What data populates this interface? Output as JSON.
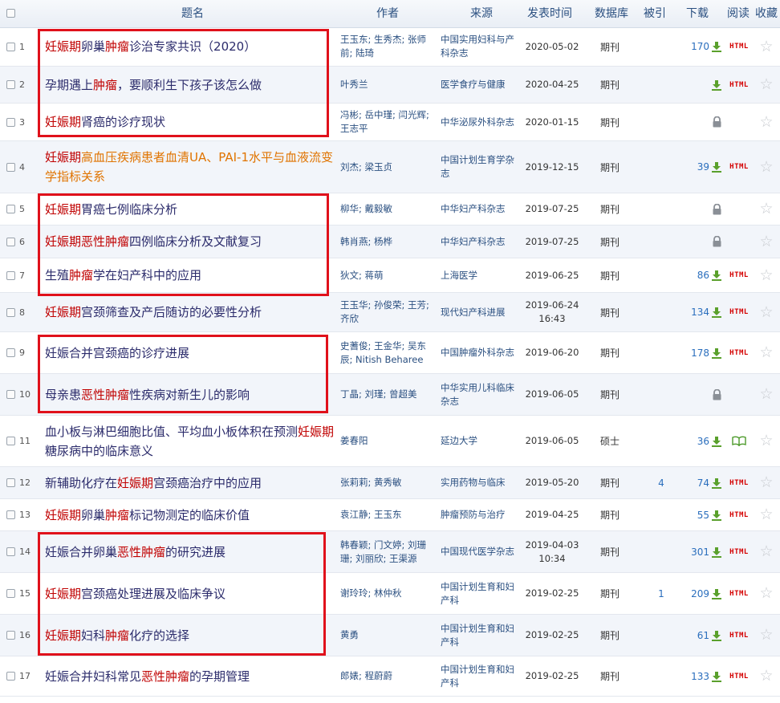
{
  "header": {
    "title": "题名",
    "author": "作者",
    "source": "来源",
    "date": "发表时间",
    "db": "数据库",
    "cited": "被引",
    "download": "下载",
    "read": "阅读",
    "fav": "收藏"
  },
  "html_label": "HTML",
  "rows": [
    {
      "num": "1",
      "title": [
        [
          "妊娠期",
          true
        ],
        [
          "卵巢",
          false
        ],
        [
          "肿瘤",
          true
        ],
        [
          "诊治专家共识（2020）",
          false
        ]
      ],
      "author": "王玉东; 生秀杰; 张师前; 陆琦",
      "source": "中国实用妇科与产科杂志",
      "date": "2020-05-02",
      "db": "期刊",
      "cited": "",
      "downloads": "170",
      "dl": "arrow",
      "read": "html"
    },
    {
      "num": "2",
      "title": [
        [
          "孕期遇上",
          false
        ],
        [
          "肿瘤",
          true
        ],
        [
          "，要顺利生下孩子该怎么做",
          false
        ]
      ],
      "author": "叶秀兰",
      "source": "医学食疗与健康",
      "date": "2020-04-25",
      "db": "期刊",
      "cited": "",
      "downloads": "",
      "dl": "arrow",
      "read": "html"
    },
    {
      "num": "3",
      "title": [
        [
          "妊娠期",
          true
        ],
        [
          "肾癌的诊疗现状",
          false
        ]
      ],
      "author": "冯彬; 岳中瑾; 闫光辉; 王志平",
      "source": "中华泌尿外科杂志",
      "date": "2020-01-15",
      "db": "期刊",
      "cited": "",
      "downloads": "",
      "dl": "lock",
      "read": "none"
    },
    {
      "num": "4",
      "title": [
        [
          "妊娠期",
          true
        ],
        [
          "高血压疾病患者血清UA、PAI-1水平与血液流变学指标关系",
          false
        ]
      ],
      "orange": true,
      "author": "刘杰; 梁玉贞",
      "source": "中国计划生育学杂志",
      "date": "2019-12-15",
      "db": "期刊",
      "cited": "",
      "downloads": "39",
      "dl": "arrow",
      "read": "html"
    },
    {
      "num": "5",
      "title": [
        [
          "妊娠期",
          true
        ],
        [
          "胃癌七例临床分析",
          false
        ]
      ],
      "author": "柳华; 戴毅敏",
      "source": "中华妇产科杂志",
      "date": "2019-07-25",
      "db": "期刊",
      "cited": "",
      "downloads": "",
      "dl": "lock",
      "read": "none"
    },
    {
      "num": "6",
      "title": [
        [
          "妊娠期恶性肿瘤",
          true
        ],
        [
          "四例临床分析及文献复习",
          false
        ]
      ],
      "author": "韩肖燕; 杨桦",
      "source": "中华妇产科杂志",
      "date": "2019-07-25",
      "db": "期刊",
      "cited": "",
      "downloads": "",
      "dl": "lock",
      "read": "none"
    },
    {
      "num": "7",
      "title": [
        [
          "生殖",
          false
        ],
        [
          "肿瘤",
          true
        ],
        [
          "学在妇产科中的应用",
          false
        ]
      ],
      "author": "狄文; 蒋萌",
      "source": "上海医学",
      "date": "2019-06-25",
      "db": "期刊",
      "cited": "",
      "downloads": "86",
      "dl": "arrow",
      "read": "html"
    },
    {
      "num": "8",
      "title": [
        [
          "妊娠期",
          true
        ],
        [
          "宫颈筛查及产后随访的必要性分析",
          false
        ]
      ],
      "author": "王玉华; 孙俊荣; 王芳; 齐欣",
      "source": "现代妇产科进展",
      "date": "2019-06-24 16:43",
      "db": "期刊",
      "cited": "",
      "downloads": "134",
      "dl": "arrow",
      "read": "html"
    },
    {
      "num": "9",
      "title": [
        [
          "妊娠合并宫颈癌的诊疗进展",
          false
        ]
      ],
      "author": "史蓍俊; 王金华; 吴东辰; Nitish Beharee",
      "source": "中国肿瘤外科杂志",
      "date": "2019-06-20",
      "db": "期刊",
      "cited": "",
      "downloads": "178",
      "dl": "arrow",
      "read": "html"
    },
    {
      "num": "10",
      "title": [
        [
          "母亲患",
          false
        ],
        [
          "恶性肿瘤",
          true
        ],
        [
          "性疾病对新生儿的影响",
          false
        ]
      ],
      "author": "丁晶; 刘瑾; 曾超美",
      "source": "中华实用儿科临床杂志",
      "date": "2019-06-05",
      "db": "期刊",
      "cited": "",
      "downloads": "",
      "dl": "lock",
      "read": "none"
    },
    {
      "num": "11",
      "title": [
        [
          "血小板与淋巴细胞比值、平均血小板体积在预测",
          false
        ],
        [
          "妊娠期",
          true
        ],
        [
          "糖尿病中的临床意义",
          false
        ]
      ],
      "author": "姜春阳",
      "source": "延边大学",
      "date": "2019-06-05",
      "db": "硕士",
      "cited": "",
      "downloads": "36",
      "dl": "arrow",
      "read": "book"
    },
    {
      "num": "12",
      "title": [
        [
          "新辅助化疗在",
          false
        ],
        [
          "妊娠期",
          true
        ],
        [
          "宫颈癌治疗中的应用",
          false
        ]
      ],
      "author": "张莉莉; 黄秀敏",
      "source": "实用药物与临床",
      "date": "2019-05-20",
      "db": "期刊",
      "cited": "4",
      "downloads": "74",
      "dl": "arrow",
      "read": "html"
    },
    {
      "num": "13",
      "title": [
        [
          "妊娠期",
          true
        ],
        [
          "卵巢",
          false
        ],
        [
          "肿瘤",
          true
        ],
        [
          "标记物测定的临床价值",
          false
        ]
      ],
      "author": "袁江静; 王玉东",
      "source": "肿瘤预防与治疗",
      "date": "2019-04-25",
      "db": "期刊",
      "cited": "",
      "downloads": "55",
      "dl": "arrow",
      "read": "html"
    },
    {
      "num": "14",
      "title": [
        [
          "妊娠合并卵巢",
          false
        ],
        [
          "恶性肿瘤",
          true
        ],
        [
          "的研究进展",
          false
        ]
      ],
      "author": "韩春颖; 门文婷; 刘珊珊; 刘丽欣; 王渠源",
      "source": "中国现代医学杂志",
      "date": "2019-04-03 10:34",
      "db": "期刊",
      "cited": "",
      "downloads": "301",
      "dl": "arrow",
      "read": "html"
    },
    {
      "num": "15",
      "title": [
        [
          "妊娠期",
          true
        ],
        [
          "宫颈癌处理进展及临床争议",
          false
        ]
      ],
      "author": "谢玲玲; 林仲秋",
      "source": "中国计划生育和妇产科",
      "date": "2019-02-25",
      "db": "期刊",
      "cited": "1",
      "downloads": "209",
      "dl": "arrow",
      "read": "html"
    },
    {
      "num": "16",
      "title": [
        [
          "妊娠期",
          true
        ],
        [
          "妇科",
          false
        ],
        [
          "肿瘤",
          true
        ],
        [
          "化疗的选择",
          false
        ]
      ],
      "author": "黄勇",
      "source": "中国计划生育和妇产科",
      "date": "2019-02-25",
      "db": "期刊",
      "cited": "",
      "downloads": "61",
      "dl": "arrow",
      "read": "html"
    },
    {
      "num": "17",
      "title": [
        [
          "妊娠合并妇科常见",
          false
        ],
        [
          "恶性肿瘤",
          true
        ],
        [
          "的孕期管理",
          false
        ]
      ],
      "author": "郎婊; 程蔚蔚",
      "source": "中国计划生育和妇产科",
      "date": "2019-02-25",
      "db": "期刊",
      "cited": "",
      "downloads": "133",
      "dl": "arrow",
      "read": "html"
    }
  ]
}
